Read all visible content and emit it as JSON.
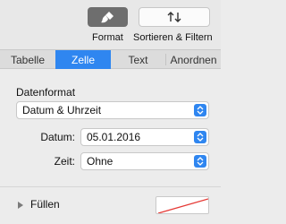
{
  "toolbar": {
    "format_label": "Format",
    "sort_filter_label": "Sortieren & Filtern",
    "format_icon": "paintbrush-icon",
    "sort_icon": "sort-arrows-icon"
  },
  "tabs": [
    {
      "label": "Tabelle",
      "selected": false
    },
    {
      "label": "Zelle",
      "selected": true
    },
    {
      "label": "Text",
      "selected": false
    },
    {
      "label": "Anordnen",
      "selected": false
    }
  ],
  "data_format": {
    "title": "Datenformat",
    "selected": "Datum & Uhrzeit",
    "date": {
      "label": "Datum:",
      "value": "05.01.2016"
    },
    "time": {
      "label": "Zeit:",
      "value": "Ohne"
    }
  },
  "fill": {
    "label": "Füllen",
    "swatch": "none"
  },
  "colors": {
    "accent": "#2f86f0",
    "active_toolbar_button": "#6e6e6e"
  }
}
